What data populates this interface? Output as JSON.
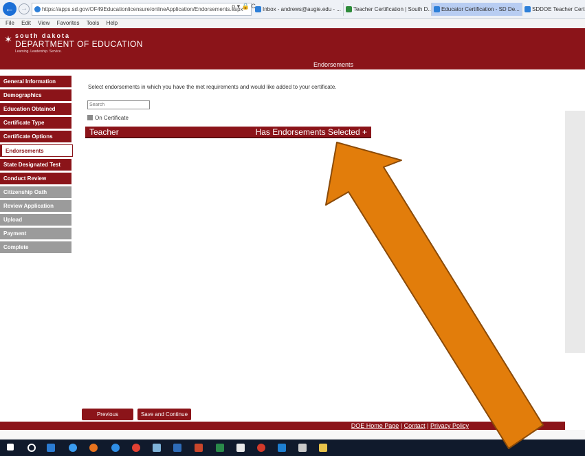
{
  "browser": {
    "url": "https://apps.sd.gov/OF49Educationlicensure/onlineApplication/Endorsements.aspx",
    "url_actions": "ρ ▾ 🔒 C",
    "tabs": [
      {
        "label": "Inbox - andrews@augie.edu - ..."
      },
      {
        "label": "Teacher Certification | South D..."
      },
      {
        "label": "Educator Certification - SD De..."
      },
      {
        "label": "SDDOE Teacher Certificati"
      }
    ],
    "menu": [
      "File",
      "Edit",
      "View",
      "Favorites",
      "Tools",
      "Help"
    ]
  },
  "header": {
    "logo_line1": "south dakota",
    "logo_line2": "DEPARTMENT OF EDUCATION",
    "logo_line3": "Learning. Leadership. Service.",
    "page_title": "Endorsements"
  },
  "sidebar": {
    "items": [
      {
        "label": "General Information",
        "state": "red"
      },
      {
        "label": "Demographics",
        "state": "red"
      },
      {
        "label": "Education Obtained",
        "state": "red"
      },
      {
        "label": "Certificate Type",
        "state": "red"
      },
      {
        "label": "Certificate Options",
        "state": "red"
      },
      {
        "label": "Endorsements",
        "state": "current"
      },
      {
        "label": "State Designated Test",
        "state": "red"
      },
      {
        "label": "Conduct Review",
        "state": "red"
      },
      {
        "label": "Citizenship Oath",
        "state": "gray"
      },
      {
        "label": "Review Application",
        "state": "gray"
      },
      {
        "label": "Upload",
        "state": "gray"
      },
      {
        "label": "Payment",
        "state": "gray"
      },
      {
        "label": "Complete",
        "state": "gray"
      }
    ]
  },
  "main": {
    "instructions": "Select endorsements in which you have the met requirements and would like added to your certificate.",
    "search_placeholder": "Search",
    "on_certificate_label": "On Certificate",
    "teacher_label": "Teacher",
    "teacher_status": "Has Endorsements Selected +"
  },
  "buttons": {
    "previous": "Previous",
    "save_continue": "Save and Continue"
  },
  "footer": {
    "home": "DOE Home Page",
    "sep": " | ",
    "contact": "Contact",
    "privacy": "Privacy Policy"
  },
  "colors": {
    "brand": "#8b1419",
    "disabled": "#9b9b9b",
    "arrow": "#e27d0b"
  }
}
